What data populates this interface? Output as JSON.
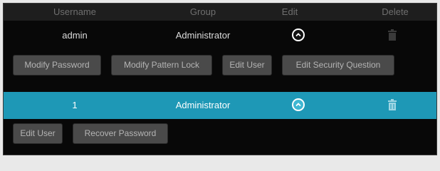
{
  "columns": {
    "username": "Username",
    "group": "Group",
    "edit": "Edit",
    "delete": "Delete"
  },
  "users": [
    {
      "username": "admin",
      "group": "Administrator",
      "edit_icon": "chevron-up-circle-icon",
      "delete_icon": "trash-icon",
      "selected": false,
      "actions": [
        "Modify Password",
        "Modify Pattern Lock",
        "Edit User",
        "Edit Security Question"
      ]
    },
    {
      "username": "1",
      "group": "Administrator",
      "edit_icon": "chevron-up-circle-icon",
      "delete_icon": "trash-icon",
      "selected": true,
      "actions": [
        "Edit User",
        "Recover Password"
      ]
    }
  ],
  "colors": {
    "selected_row": "#1e98b6",
    "background": "#080808",
    "header": "#1e1e1e",
    "button": "#4a4a4a"
  }
}
